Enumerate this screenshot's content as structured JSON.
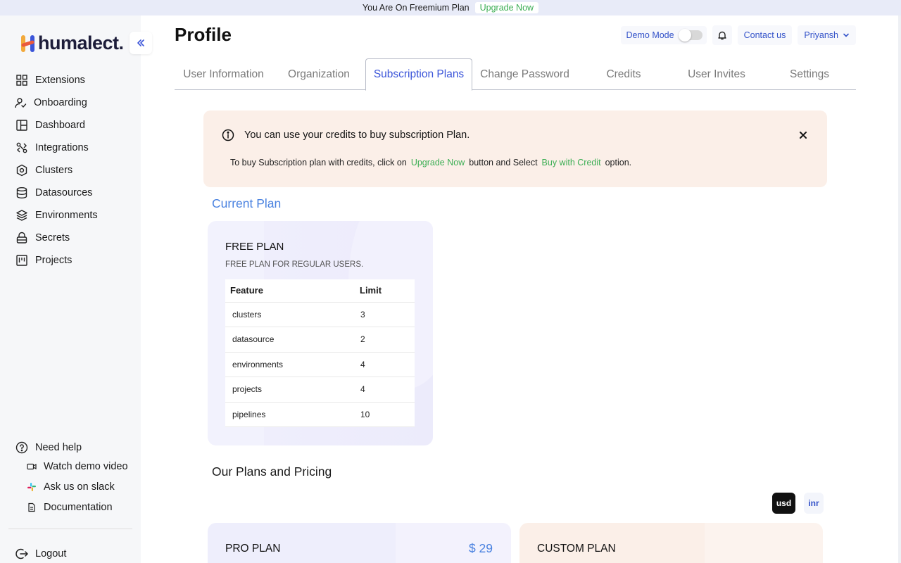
{
  "banner": {
    "text": "You Are On Freemium Plan",
    "upgrade": "Upgrade Now"
  },
  "brand": {
    "name": "humalect.",
    "accent_colors": [
      "#f2a93b",
      "#3b55d9"
    ]
  },
  "sidebar": {
    "items": [
      {
        "label": "Extensions",
        "icon": "grid-icon"
      },
      {
        "label": "Onboarding",
        "icon": "user-check-icon"
      },
      {
        "label": "Dashboard",
        "icon": "dashboard-icon"
      },
      {
        "label": "Integrations",
        "icon": "integrations-icon"
      },
      {
        "label": "Clusters",
        "icon": "cluster-icon"
      },
      {
        "label": "Datasources",
        "icon": "database-icon"
      },
      {
        "label": "Environments",
        "icon": "layers-icon"
      },
      {
        "label": "Secrets",
        "icon": "lock-icon"
      },
      {
        "label": "Projects",
        "icon": "kanban-icon"
      }
    ],
    "help": {
      "title": "Need help",
      "links": [
        {
          "label": "Watch demo video",
          "icon": "video-icon"
        },
        {
          "label": "Ask us on slack",
          "icon": "slack-icon"
        },
        {
          "label": "Documentation",
          "icon": "document-icon"
        }
      ]
    },
    "logout": "Logout"
  },
  "header": {
    "title": "Profile",
    "demo_mode": "Demo Mode",
    "demo_mode_on": false,
    "contact": "Contact us",
    "user": "Priyansh"
  },
  "tabs": [
    {
      "label": "User Information",
      "active": false
    },
    {
      "label": "Organization",
      "active": false
    },
    {
      "label": "Subscription Plans",
      "active": true
    },
    {
      "label": "Change Password",
      "active": false
    },
    {
      "label": "Credits",
      "active": false
    },
    {
      "label": "User Invites",
      "active": false
    },
    {
      "label": "Settings",
      "active": false
    }
  ],
  "alert": {
    "message": "You can use your credits to buy subscription Plan.",
    "detail_prefix": "To buy Subscription plan with credits, click on",
    "detail_link1": "Upgrade Now",
    "detail_mid": "button and Select",
    "detail_link2": "Buy with Credit",
    "detail_suffix": "option."
  },
  "current_plan": {
    "section_title": "Current Plan",
    "name": "FREE PLAN",
    "description": "FREE PLAN FOR REGULAR USERS.",
    "columns": [
      "Feature",
      "Limit"
    ],
    "rows": [
      [
        "clusters",
        "3"
      ],
      [
        "datasource",
        "2"
      ],
      [
        "environments",
        "4"
      ],
      [
        "projects",
        "4"
      ],
      [
        "pipelines",
        "10"
      ]
    ]
  },
  "pricing": {
    "section_title": "Our Plans and Pricing",
    "currencies": [
      "usd",
      "inr"
    ],
    "selected_currency": "usd",
    "plans": [
      {
        "name": "PRO PLAN",
        "price": "$ 29"
      },
      {
        "name": "CUSTOM PLAN",
        "price": ""
      }
    ]
  }
}
